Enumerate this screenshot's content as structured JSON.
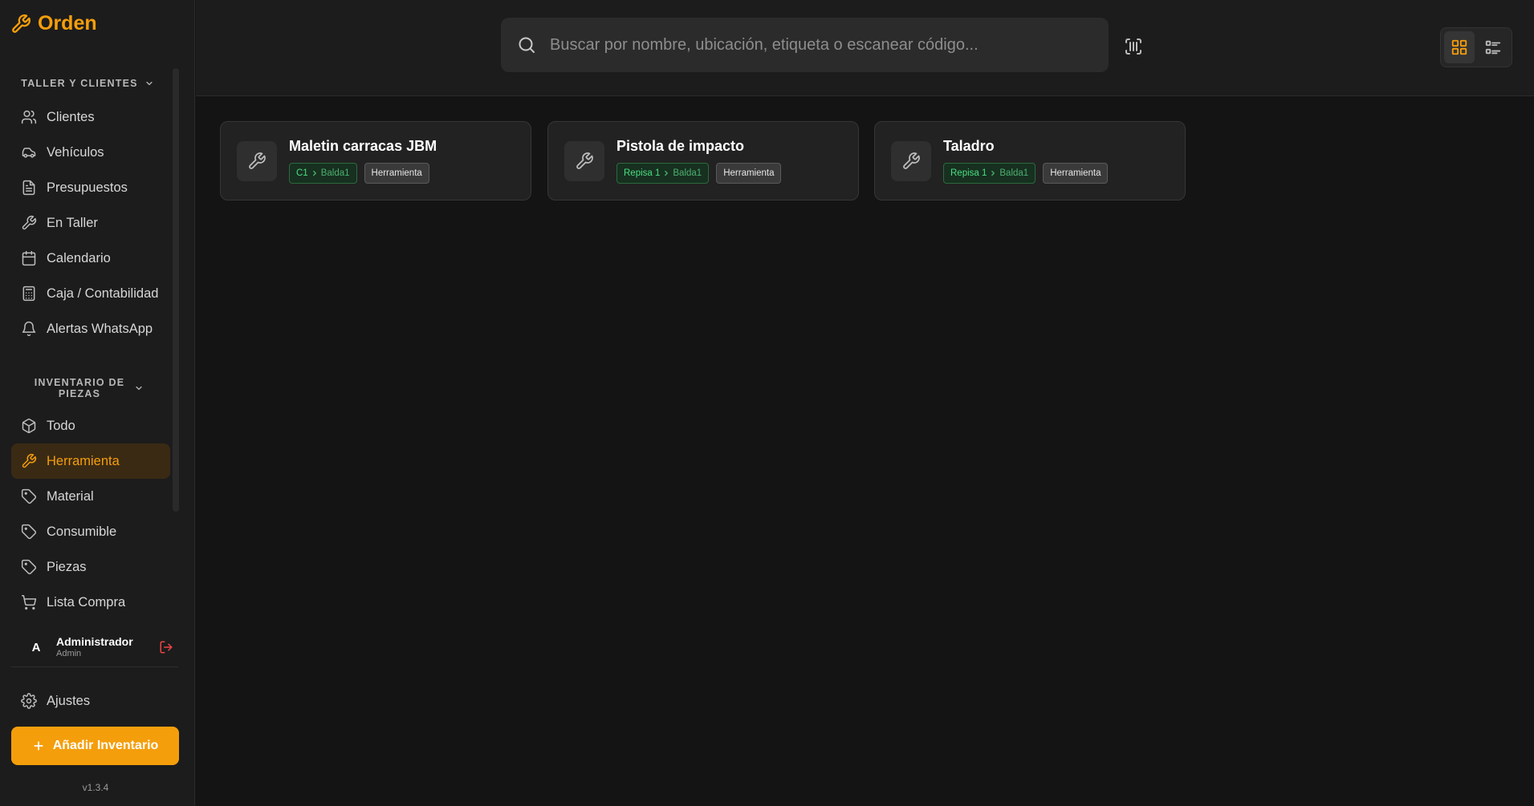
{
  "app": {
    "name": "Orden",
    "accent": "#f59e0b"
  },
  "sidebar": {
    "section1": {
      "title": "TALLER Y CLIENTES",
      "items": [
        {
          "label": "Clientes",
          "icon": "users-icon"
        },
        {
          "label": "Vehículos",
          "icon": "car-icon"
        },
        {
          "label": "Presupuestos",
          "icon": "document-icon"
        },
        {
          "label": "En Taller",
          "icon": "wrench-icon"
        },
        {
          "label": "Calendario",
          "icon": "calendar-icon"
        },
        {
          "label": "Caja / Contabilidad",
          "icon": "calculator-icon"
        },
        {
          "label": "Alertas WhatsApp",
          "icon": "bell-icon"
        }
      ]
    },
    "section2": {
      "title": "INVENTARIO DE PIEZAS",
      "items": [
        {
          "label": "Todo",
          "icon": "box-icon"
        },
        {
          "label": "Herramienta",
          "icon": "wrench-icon",
          "active": true
        },
        {
          "label": "Material",
          "icon": "tag-icon"
        },
        {
          "label": "Consumible",
          "icon": "tag-icon"
        },
        {
          "label": "Piezas",
          "icon": "tag-icon"
        },
        {
          "label": "Lista Compra",
          "icon": "cart-icon"
        }
      ]
    },
    "user": {
      "initial": "A",
      "name": "Administrador",
      "role": "Admin"
    },
    "settings_label": "Ajustes",
    "add_button_label": "Añadir Inventario",
    "version": "v1.3.4"
  },
  "search": {
    "placeholder": "Buscar por nombre, ubicación, etiqueta o escanear código..."
  },
  "view_modes": [
    "grid",
    "list"
  ],
  "items": [
    {
      "title": "Maletin carracas JBM",
      "location": "C1",
      "sublocation": "Balda1",
      "category": "Herramienta"
    },
    {
      "title": "Pistola de impacto",
      "location": "Repisa 1",
      "sublocation": "Balda1",
      "category": "Herramienta"
    },
    {
      "title": "Taladro",
      "location": "Repisa 1",
      "sublocation": "Balda1",
      "category": "Herramienta"
    }
  ]
}
